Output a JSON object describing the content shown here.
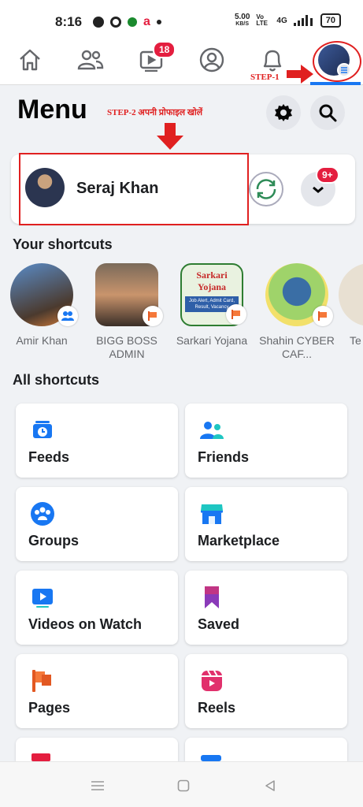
{
  "status_bar": {
    "time": "8:16",
    "speed_value": "5.00",
    "speed_unit": "KB/S",
    "network": "Vo LTE",
    "signal": "4G",
    "battery": "70"
  },
  "nav": {
    "watch_badge": "18"
  },
  "annotations": {
    "step1": "STEP-1",
    "step2": "STEP-2 अपनी प्रोफाइल खोलें"
  },
  "header": {
    "title": "Menu"
  },
  "profile": {
    "name": "Seraj Khan",
    "notif_badge": "9+"
  },
  "shortcuts": {
    "title": "Your shortcuts",
    "items": [
      {
        "label": "Amir Khan"
      },
      {
        "label": "BIGG BOSS ADMIN"
      },
      {
        "label": "Sarkari Yojana"
      },
      {
        "label": "Shahin CYBER CAF..."
      },
      {
        "label": "Te"
      }
    ],
    "sarkari_thumb_title": "Sarkari Yojana",
    "sarkari_thumb_lines": "Job Alert, Admit Card, Result, Vacancy"
  },
  "all_shortcuts": {
    "title": "All shortcuts",
    "items": [
      {
        "label": "Feeds"
      },
      {
        "label": "Friends"
      },
      {
        "label": "Groups"
      },
      {
        "label": "Marketplace"
      },
      {
        "label": "Videos on Watch"
      },
      {
        "label": "Saved"
      },
      {
        "label": "Pages"
      },
      {
        "label": "Reels"
      }
    ]
  },
  "colors": {
    "accent": "#1877f2",
    "badge_red": "#e41e3f",
    "annotation_red": "#e02020"
  }
}
